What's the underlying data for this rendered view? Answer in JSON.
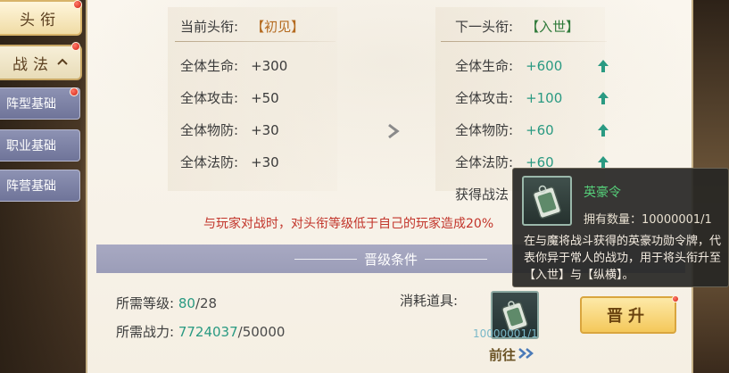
{
  "tabs": {
    "title_tab": "头衔",
    "tactics_tab": "战法",
    "sub_items": [
      "阵型基础",
      "职业基础",
      "阵营基础"
    ]
  },
  "current": {
    "header_label": "当前头衔:",
    "title": "【初见】",
    "stats": [
      {
        "label": "全体生命:",
        "value": "+300"
      },
      {
        "label": "全体攻击:",
        "value": "+50"
      },
      {
        "label": "全体物防:",
        "value": "+30"
      },
      {
        "label": "全体法防:",
        "value": "+30"
      }
    ]
  },
  "next": {
    "header_label": "下一头衔:",
    "title": "【入世】",
    "stats": [
      {
        "label": "全体生命:",
        "value": "+600"
      },
      {
        "label": "全体攻击:",
        "value": "+100"
      },
      {
        "label": "全体物防:",
        "value": "+60"
      },
      {
        "label": "全体法防:",
        "value": "+60"
      }
    ],
    "gain_label": "获得战法"
  },
  "warning": "与玩家对战时，对头衔等级低于自己的玩家造成20%",
  "conditions": {
    "bar_title": "晋级条件",
    "level_label": "所需等级:",
    "level_current": "80",
    "level_required": "28",
    "power_label": "所需战力:",
    "power_current": "7724037",
    "power_required": "50000",
    "consume_label": "消耗道具:",
    "item_count": "10000001/1",
    "goto_label": "前往",
    "promote_label": "晋升"
  },
  "tooltip": {
    "name": "英豪令",
    "own": "拥有数量：10000001/1",
    "desc": "在与魔将战斗获得的英豪功勋令牌，代表你异于常人的战功，用于将头衔升至【入世】与【纵横】。"
  },
  "colors": {
    "accent_green": "#2a9a82",
    "warn_red": "#c2342a",
    "tooltip_name": "#56d07a"
  }
}
